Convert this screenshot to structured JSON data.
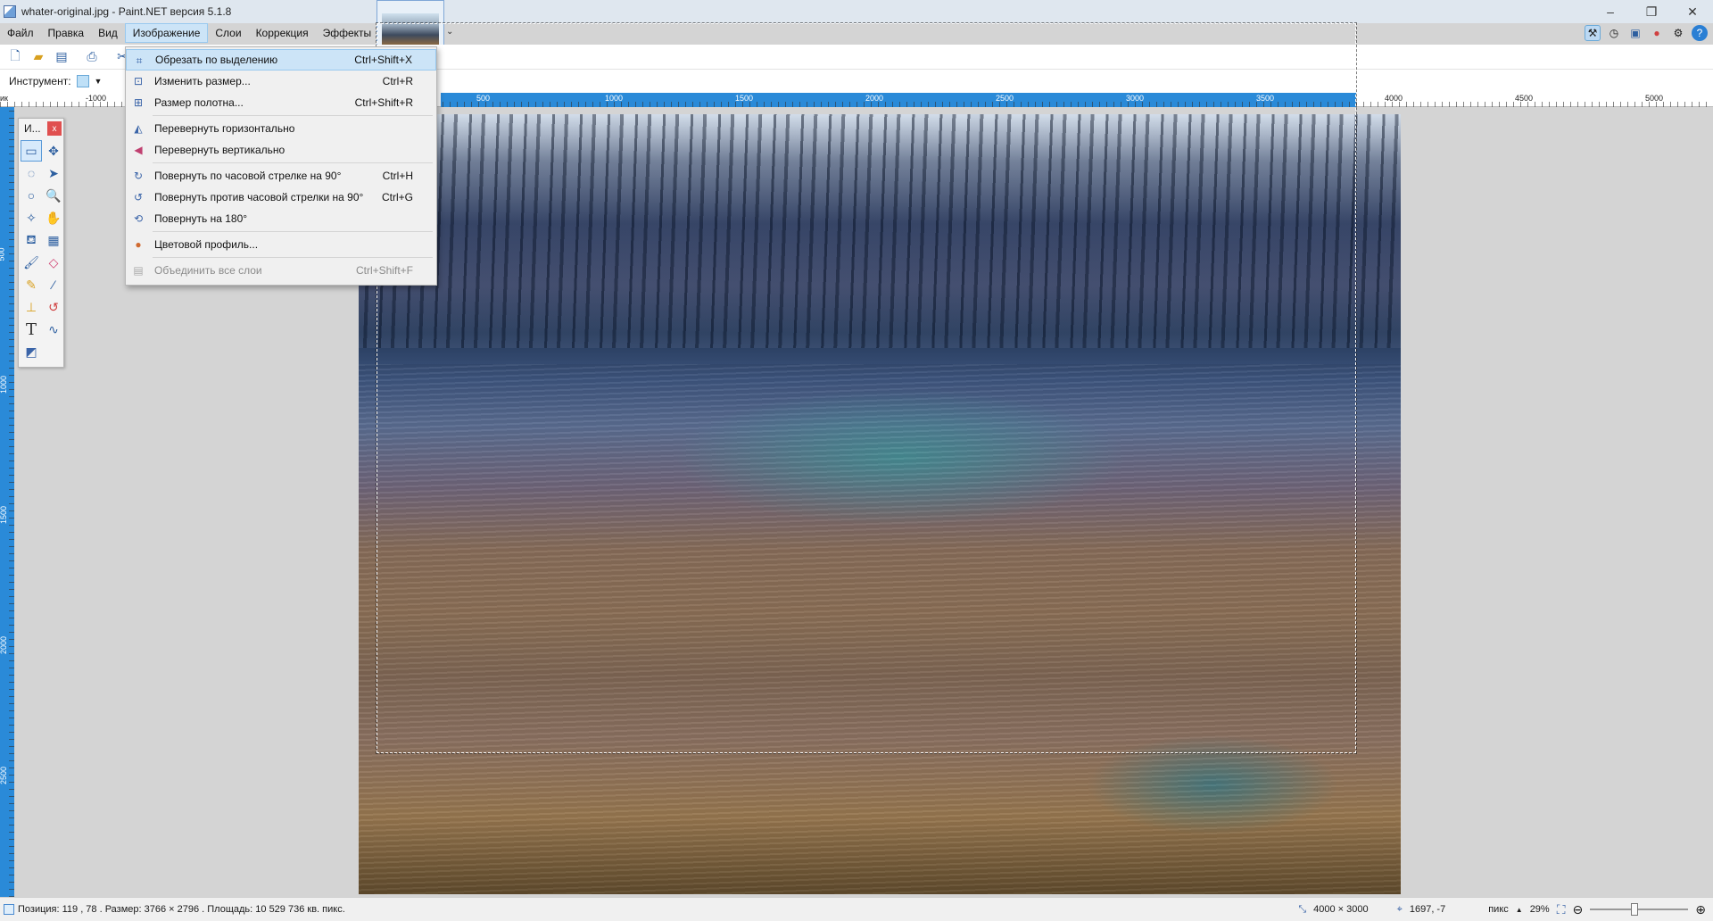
{
  "window": {
    "title": "whater-original.jpg - Paint.NET версия 5.1.8"
  },
  "menubar": {
    "items": [
      {
        "label": "Файл"
      },
      {
        "label": "Правка"
      },
      {
        "label": "Вид"
      },
      {
        "label": "Изображение",
        "active": true
      },
      {
        "label": "Слои"
      },
      {
        "label": "Коррекция"
      },
      {
        "label": "Эффекты"
      }
    ]
  },
  "toolbar2": {
    "tool_label": "Инструмент:"
  },
  "ruler_top": {
    "labels": [
      "-1000",
      "500",
      "1000",
      "1500",
      "2000",
      "2500",
      "3000",
      "3500",
      "4000",
      "4500",
      "5000"
    ],
    "unit_prefix": "ик"
  },
  "ruler_left": {
    "labels": [
      "500",
      "1000",
      "1500",
      "2000",
      "2500"
    ]
  },
  "tools_window": {
    "title": "И...",
    "close": "x"
  },
  "image_menu": {
    "items": [
      {
        "label": "Обрезать по выделению",
        "shortcut": "Ctrl+Shift+X",
        "icon": "crop-icon",
        "highlighted": true
      },
      {
        "label": "Изменить размер...",
        "shortcut": "Ctrl+R",
        "icon": "resize-icon"
      },
      {
        "label": "Размер полотна...",
        "shortcut": "Ctrl+Shift+R",
        "icon": "canvas-size-icon"
      },
      {
        "sep": true
      },
      {
        "label": "Перевернуть горизонтально",
        "shortcut": "",
        "icon": "flip-horizontal-icon"
      },
      {
        "label": "Перевернуть вертикально",
        "shortcut": "",
        "icon": "flip-vertical-icon"
      },
      {
        "sep": true
      },
      {
        "label": "Повернуть по часовой стрелке на 90°",
        "shortcut": "Ctrl+H",
        "icon": "rotate-cw-icon"
      },
      {
        "label": "Повернуть против часовой стрелки на 90°",
        "shortcut": "Ctrl+G",
        "icon": "rotate-ccw-icon"
      },
      {
        "label": "Повернуть на 180°",
        "shortcut": "",
        "icon": "rotate-180-icon"
      },
      {
        "sep": true
      },
      {
        "label": "Цветовой профиль...",
        "shortcut": "",
        "icon": "color-profile-icon"
      },
      {
        "sep": true
      },
      {
        "label": "Объединить все слои",
        "shortcut": "Ctrl+Shift+F",
        "icon": "flatten-icon",
        "disabled": true
      }
    ]
  },
  "status": {
    "info": "Позиция: 119 , 78 . Размер: 3766  × 2796 . Площадь: 10 529 736 кв. пикс.",
    "image_size": "4000 × 3000",
    "cursor_pos": "1697, -7",
    "unit": "пикс",
    "zoom": "29%",
    "zoom_level": 0.29
  },
  "colors": {
    "accent": "#2a8ad8",
    "menu_highlight": "#cce4f7"
  }
}
